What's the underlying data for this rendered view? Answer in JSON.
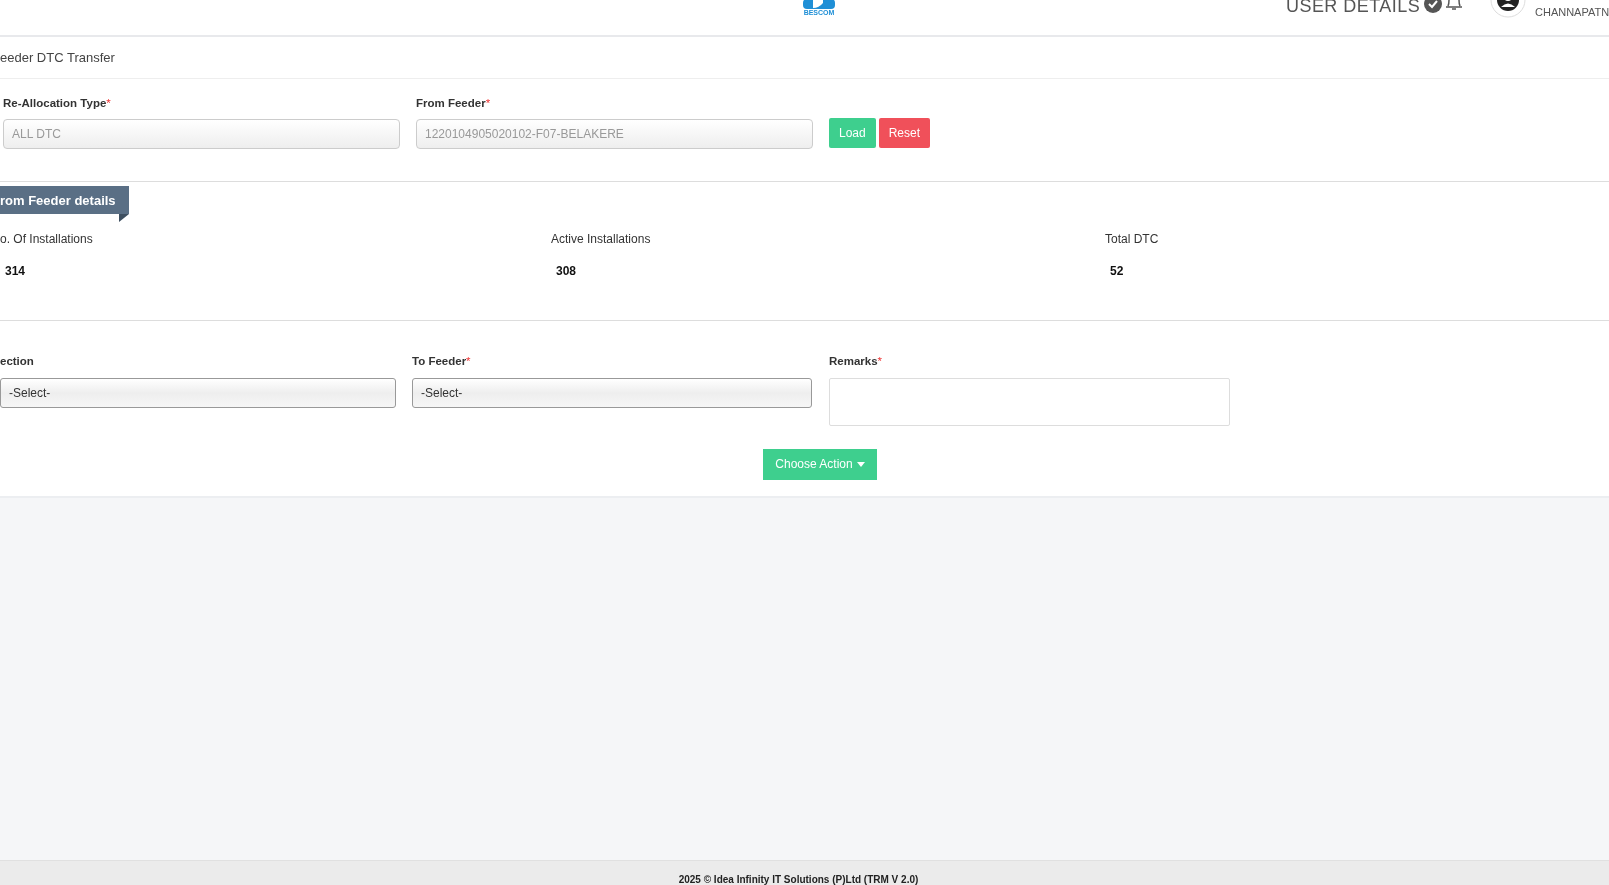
{
  "header": {
    "logo_text": "BESCOM",
    "user_menu": "USER DETAILS",
    "user_location": "CHANNAPATN"
  },
  "page_title": "eeder DTC Transfer",
  "required_mark": "*",
  "load_form": {
    "fields": [
      {
        "label": "Re-Allocation Type",
        "required": true,
        "value": "ALL DTC"
      },
      {
        "label": "From Feeder",
        "required": true,
        "value": "1220104905020102-F07-BELAKERE"
      }
    ],
    "buttons": [
      {
        "label": "Load",
        "kind": "success"
      },
      {
        "label": "Reset",
        "kind": "danger"
      }
    ]
  },
  "details": {
    "title": "rom Feeder details",
    "stats": [
      {
        "label": "o. Of Installations",
        "value": "314"
      },
      {
        "label": "Active Installations",
        "value": "308"
      },
      {
        "label": "Total DTC",
        "value": "52"
      }
    ]
  },
  "transfer_form": {
    "fields": [
      {
        "label": "ection",
        "required": false,
        "kind": "select",
        "value": "-Select-"
      },
      {
        "label": "To Feeder",
        "required": true,
        "kind": "select",
        "value": "-Select-"
      },
      {
        "label": "Remarks",
        "required": true,
        "kind": "textarea"
      }
    ],
    "action_button": "Choose Action"
  },
  "footer": "2025 © Idea Infinity IT Solutions (P)Ltd (TRM V 2.0)"
}
